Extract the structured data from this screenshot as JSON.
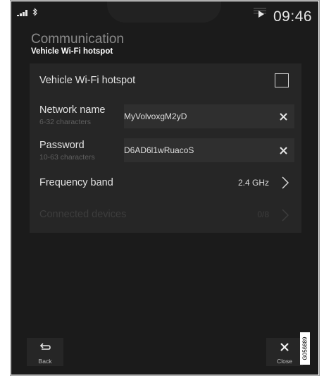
{
  "status": {
    "time": "09:46",
    "icons": [
      "signal-icon",
      "bluetooth-icon",
      "play-icon"
    ]
  },
  "header": {
    "title": "Communication",
    "subtitle": "Vehicle Wi-Fi hotspot"
  },
  "settings": {
    "hotspot": {
      "label": "Vehicle Wi-Fi hotspot",
      "checked": false
    },
    "network_name": {
      "label": "Network name",
      "hint": "6-32 characters",
      "value": "MyVolvoxgM2yD"
    },
    "password": {
      "label": "Password",
      "hint": "10-63 characters",
      "value": "D6AD6l1wRuacoS"
    },
    "frequency_band": {
      "label": "Frequency band",
      "value": "2.4 GHz"
    },
    "connected_devices": {
      "label": "Connected devices",
      "value": "0/8",
      "enabled": false
    }
  },
  "buttons": {
    "back": "Back",
    "close": "Close"
  },
  "watermark": "G056889",
  "colors": {
    "background": "#1b1b1b",
    "panel": "#262626",
    "field": "#2f2f2f",
    "text": "#e3e3e3",
    "muted": "#5f5f5f"
  }
}
